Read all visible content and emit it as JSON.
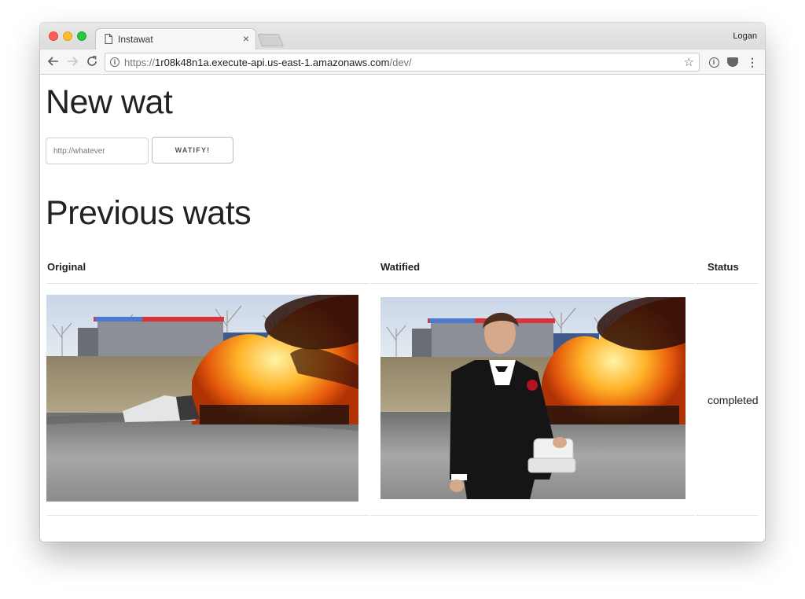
{
  "browser": {
    "tab_title": "Instawat",
    "tab_close": "×",
    "profile_name": "Logan",
    "url_scheme": "https://",
    "url_host": "1r08k48n1a.execute-api.us-east-1.amazonaws.com",
    "url_path": "/dev/",
    "icons": [
      "document-icon",
      "back-arrow-icon",
      "forward-arrow-icon",
      "reload-icon",
      "info-icon",
      "star-icon",
      "pocket-icon",
      "menu-icon"
    ]
  },
  "page": {
    "new_heading": "New wat",
    "url_placeholder": "http://whatever",
    "watify_label": "WATIFY!",
    "previous_heading": "Previous wats",
    "table": {
      "columns": [
        "Original",
        "Watified",
        "Status"
      ],
      "rows": [
        {
          "status": "completed"
        }
      ]
    }
  },
  "colors": {
    "close": "#fd5f57",
    "minimize": "#febc2e",
    "maximize": "#28c840"
  }
}
